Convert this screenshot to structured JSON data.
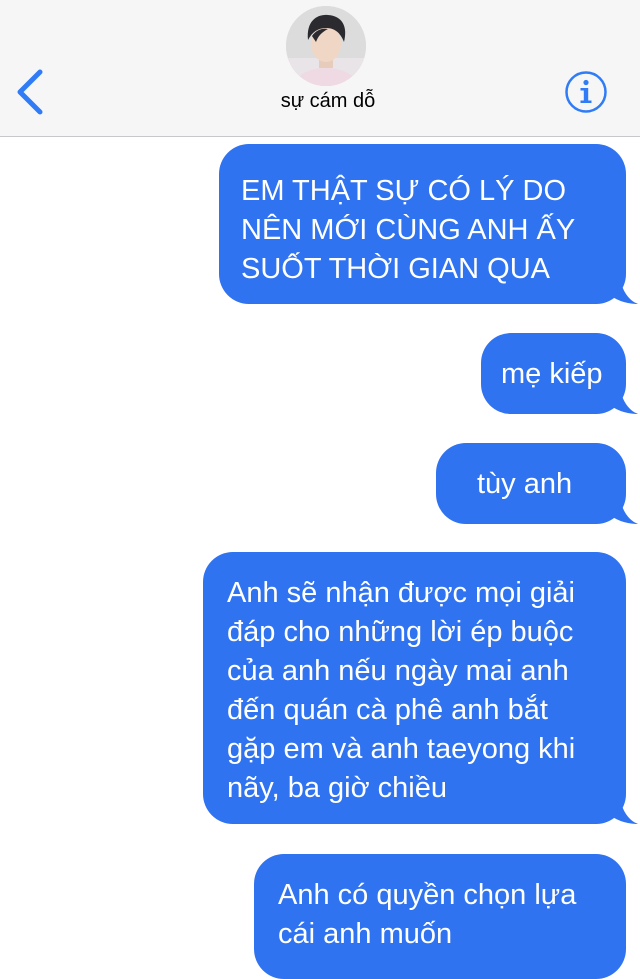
{
  "header": {
    "contact_name": "sự cám dỗ",
    "back_icon": "chevron-left-icon",
    "info_icon": "info-icon",
    "accent_color": "#2f7cf6",
    "background_color": "#f6f6f6"
  },
  "messages": [
    {
      "direction": "outgoing",
      "text": "EM THẬT SỰ CÓ LÝ DO\nNÊN MỚI CÙNG ANH ẤY\nSUỐT THỜI GIAN QUA"
    },
    {
      "direction": "outgoing",
      "text": "mẹ kiếp"
    },
    {
      "direction": "outgoing",
      "text": "tùy anh"
    },
    {
      "direction": "outgoing",
      "text": "Anh sẽ nhận được mọi giải\nđáp cho những lời ép buộc\ncủa anh nếu ngày mai anh\nđến quán cà phê anh bắt\ngặp em và anh taeyong khi\nnãy, ba giờ chiều"
    },
    {
      "direction": "outgoing",
      "text": "Anh có quyền chọn lựa\ncái anh muốn"
    }
  ],
  "colors": {
    "bubble_outgoing": "#2f73f1",
    "bubble_text": "#ffffff"
  }
}
